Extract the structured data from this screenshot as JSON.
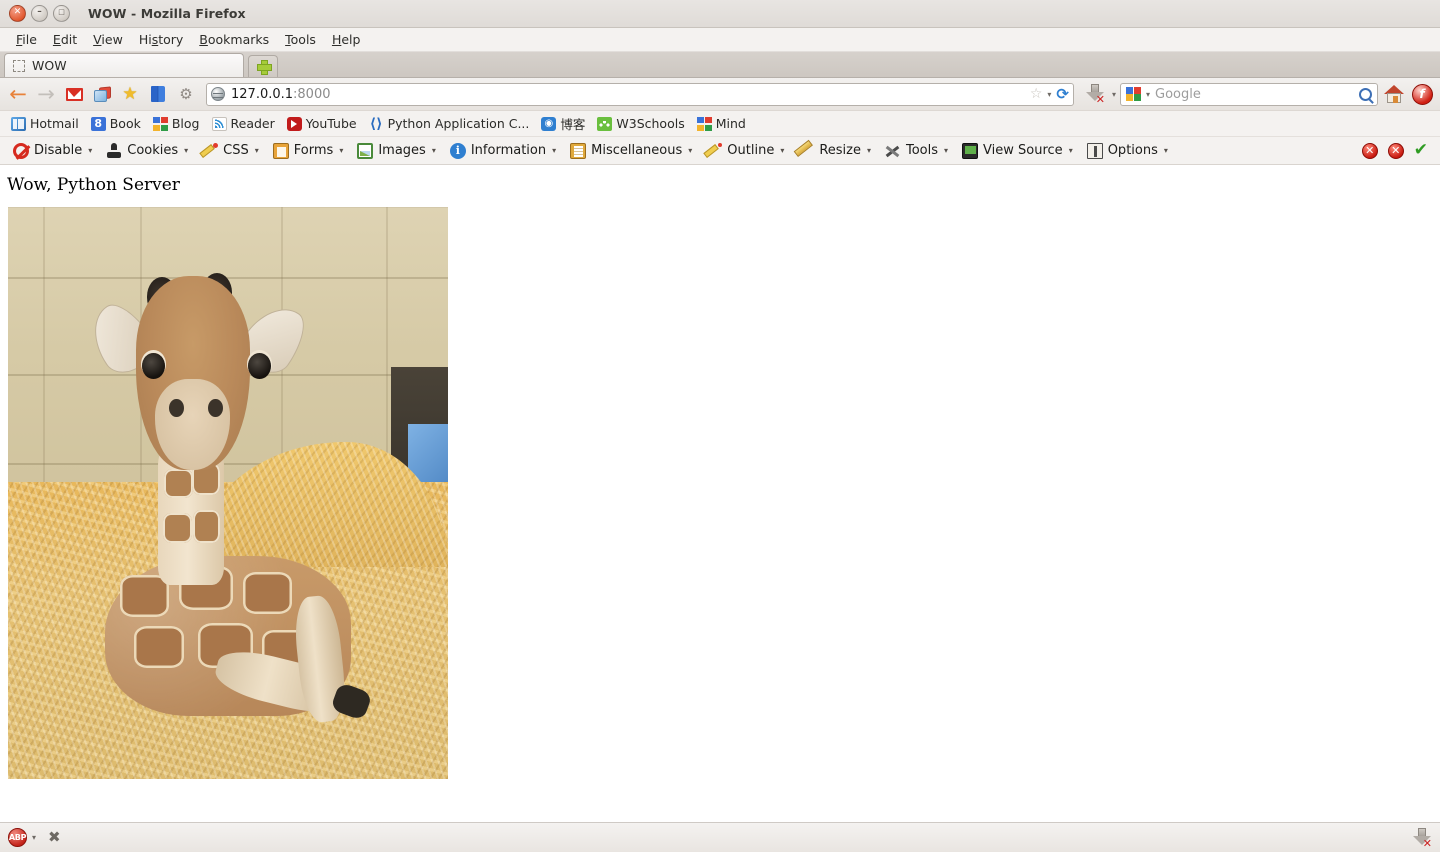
{
  "window": {
    "title": "WOW - Mozilla Firefox",
    "controls": {
      "close": "close-button",
      "minimize": "minimize-button",
      "maximize": "maximize-button"
    }
  },
  "menubar": {
    "items": [
      {
        "label": "File"
      },
      {
        "label": "Edit"
      },
      {
        "label": "View"
      },
      {
        "label": "History"
      },
      {
        "label": "Bookmarks"
      },
      {
        "label": "Tools"
      },
      {
        "label": "Help"
      }
    ]
  },
  "tabs": {
    "items": [
      {
        "label": "WOW",
        "active": true
      }
    ],
    "new_tab_label": "+"
  },
  "navbar": {
    "back_label": "←",
    "forward_label": "→",
    "icons": [
      "mail-icon",
      "rss-icon",
      "star-icon",
      "book-icon",
      "gear-icon"
    ],
    "url": "127.0.0.1",
    "url_port": ":8000",
    "bookmark_star": "☆",
    "reload_label": "⟳",
    "download_label": "download-icon",
    "search_placeholder": "Google",
    "home_label": "home-icon",
    "flash_label": "f"
  },
  "bookmarks": {
    "items": [
      {
        "label": "Hotmail",
        "icon": "hotmail-icon"
      },
      {
        "label": "Book",
        "icon": "google-book-icon"
      },
      {
        "label": "Blog",
        "icon": "google-blog-icon"
      },
      {
        "label": "Reader",
        "icon": "rss-reader-icon"
      },
      {
        "label": "YouTube",
        "icon": "youtube-icon"
      },
      {
        "label": "Python Application C...",
        "icon": "python-icon"
      },
      {
        "label": "博客",
        "icon": "blog-cn-icon"
      },
      {
        "label": "W3Schools",
        "icon": "w3schools-icon"
      },
      {
        "label": "Mind",
        "icon": "google-mind-icon"
      }
    ]
  },
  "devtoolbar": {
    "items": [
      {
        "label": "Disable",
        "icon": "disable-icon",
        "caret": "▾"
      },
      {
        "label": "Cookies",
        "icon": "cookies-icon",
        "caret": "▾"
      },
      {
        "label": "CSS",
        "icon": "css-icon",
        "caret": "▾"
      },
      {
        "label": "Forms",
        "icon": "forms-icon",
        "caret": "▾"
      },
      {
        "label": "Images",
        "icon": "images-icon",
        "caret": "▾"
      },
      {
        "label": "Information",
        "icon": "information-icon",
        "caret": "▾"
      },
      {
        "label": "Miscellaneous",
        "icon": "miscellaneous-icon",
        "caret": "▾"
      },
      {
        "label": "Outline",
        "icon": "outline-icon",
        "caret": "▾"
      },
      {
        "label": "Resize",
        "icon": "resize-icon",
        "caret": "▾"
      },
      {
        "label": "Tools",
        "icon": "tools-icon",
        "caret": "▾"
      },
      {
        "label": "View Source",
        "icon": "view-source-icon",
        "caret": "▾"
      },
      {
        "label": "Options",
        "icon": "options-icon",
        "caret": "▾"
      }
    ],
    "status": {
      "error1": "✕",
      "error2": "✕",
      "valid": "✔"
    }
  },
  "page": {
    "heading": "Wow, Python Server",
    "image_alt": "baby giraffe lying on straw"
  },
  "statusbar": {
    "adblock_label": "ABP",
    "adblock_caret": "▾",
    "close_label": "✖",
    "download_label": "download-icon"
  },
  "colors": {
    "accent_orange": "#e8823a",
    "error_red": "#c81a10",
    "valid_green": "#2f9c23",
    "chrome_bg": "#f2f1f0"
  }
}
